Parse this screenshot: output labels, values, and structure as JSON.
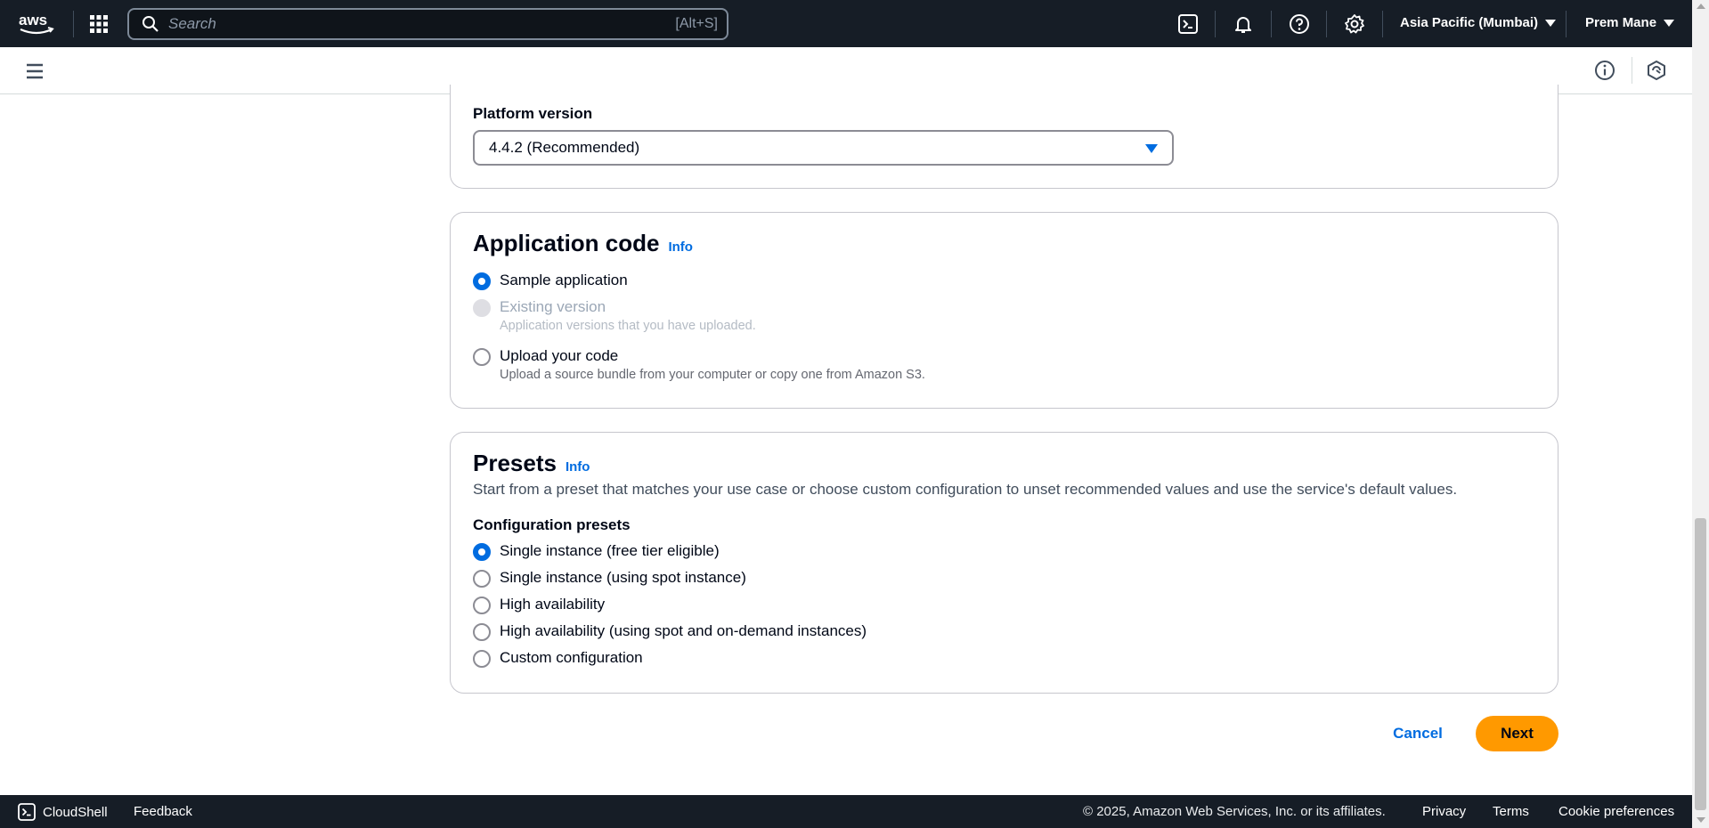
{
  "topnav": {
    "search_placeholder": "Search",
    "search_shortcut": "[Alt+S]",
    "region": "Asia Pacific (Mumbai)",
    "user": "Prem Mane"
  },
  "platform": {
    "label": "Platform version",
    "selected": "4.4.2 (Recommended)"
  },
  "app_code": {
    "title": "Application code",
    "info": "Info",
    "options": [
      {
        "label": "Sample application",
        "desc": "",
        "state": "checked"
      },
      {
        "label": "Existing version",
        "desc": "Application versions that you have uploaded.",
        "state": "disabled"
      },
      {
        "label": "Upload your code",
        "desc": "Upload a source bundle from your computer or copy one from Amazon S3.",
        "state": "unchecked"
      }
    ]
  },
  "presets": {
    "title": "Presets",
    "info": "Info",
    "description": "Start from a preset that matches your use case or choose custom configuration to unset recommended values and use the service's default values.",
    "config_label": "Configuration presets",
    "options": [
      {
        "label": "Single instance (free tier eligible)",
        "state": "checked"
      },
      {
        "label": "Single instance (using spot instance)",
        "state": "unchecked"
      },
      {
        "label": "High availability",
        "state": "unchecked"
      },
      {
        "label": "High availability (using spot and on-demand instances)",
        "state": "unchecked"
      },
      {
        "label": "Custom configuration",
        "state": "unchecked"
      }
    ]
  },
  "actions": {
    "cancel": "Cancel",
    "next": "Next"
  },
  "footer": {
    "cloudshell": "CloudShell",
    "feedback": "Feedback",
    "copyright": "© 2025, Amazon Web Services, Inc. or its affiliates.",
    "privacy": "Privacy",
    "terms": "Terms",
    "cookies": "Cookie preferences"
  },
  "colors": {
    "nav_bg": "#161d26",
    "accent_blue": "#006ce0",
    "primary_button": "#ff9900"
  }
}
